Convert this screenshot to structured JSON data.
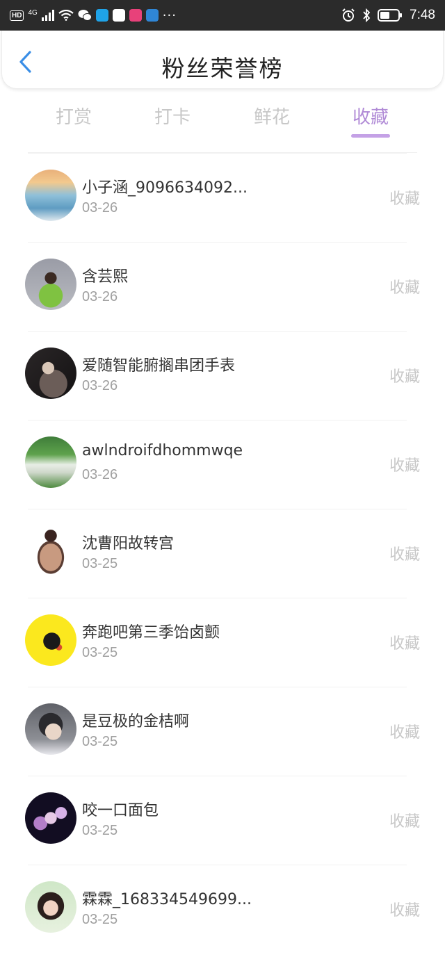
{
  "status_bar": {
    "left_label": "HD",
    "network": "4G",
    "time": "7:48",
    "more": "···",
    "icons": [
      "signal-icon",
      "wifi-icon",
      "wechat-icon",
      "search-app-icon",
      "mail-app-icon",
      "news-app-icon",
      "cloud-app-icon",
      "alarm-icon",
      "bluetooth-icon",
      "battery-icon"
    ]
  },
  "header": {
    "title": "粉丝荣誉榜",
    "back_icon": "chevron-left-icon"
  },
  "tabs": [
    {
      "label": "打赏",
      "active": false
    },
    {
      "label": "打卡",
      "active": false
    },
    {
      "label": "鲜花",
      "active": false
    },
    {
      "label": "收藏",
      "active": true
    }
  ],
  "colors": {
    "accent": "#b08ad6",
    "underline": "#c4a1e6",
    "back_icon": "#3a8ee6"
  },
  "fans": [
    {
      "name": "小子涵_9096634092...",
      "date": "03-26",
      "action": "收藏"
    },
    {
      "name": "含芸熙",
      "date": "03-26",
      "action": "收藏"
    },
    {
      "name": "爱随智能腑搁串团手表",
      "date": "03-26",
      "action": "收藏"
    },
    {
      "name": "awlndroifdhommwqe",
      "date": "03-26",
      "action": "收藏"
    },
    {
      "name": "沈曹阳故转宫",
      "date": "03-25",
      "action": "收藏"
    },
    {
      "name": "奔跑吧第三季饴卤颤",
      "date": "03-25",
      "action": "收藏"
    },
    {
      "name": "是豆极的金桔啊",
      "date": "03-25",
      "action": "收藏"
    },
    {
      "name": "咬一口面包",
      "date": "03-25",
      "action": "收藏"
    },
    {
      "name": "霖霖_168334549699...",
      "date": "03-25",
      "action": "收藏"
    }
  ]
}
